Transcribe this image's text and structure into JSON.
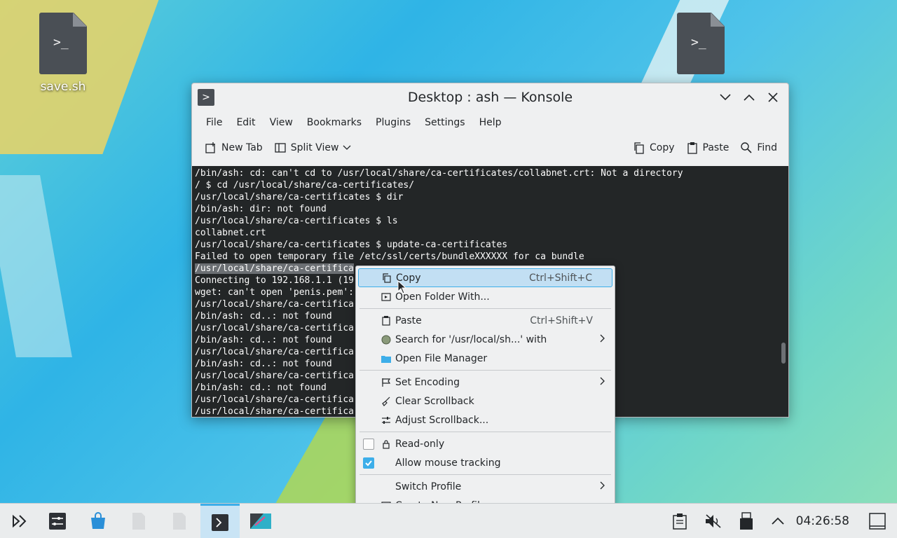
{
  "desktop": {
    "icons": [
      {
        "label": "save.sh"
      },
      {
        "label": ""
      }
    ]
  },
  "window": {
    "title": "Desktop : ash — Konsole",
    "menubar": [
      "File",
      "Edit",
      "View",
      "Bookmarks",
      "Plugins",
      "Settings",
      "Help"
    ],
    "toolbar": {
      "new_tab": "New Tab",
      "split_view": "Split View",
      "copy": "Copy",
      "paste": "Paste",
      "find": "Find"
    },
    "terminal_lines": [
      "/bin/ash: cd: can't cd to /usr/local/share/ca-certificates/collabnet.crt: Not a directory",
      "/ $ cd /usr/local/share/ca-certificates/",
      "/usr/local/share/ca-certificates $ dir",
      "/bin/ash: dir: not found",
      "/usr/local/share/ca-certificates $ ls",
      "collabnet.crt",
      "/usr/local/share/ca-certificates $ update-ca-certificates",
      "Failed to open temporary file /etc/ssl/certs/bundleXXXXXX for ca bundle",
      "/usr/local/share/ca-certifica",
      "Connecting to 192.168.1.1 (19",
      "wget: can't open 'penis.pem':",
      "/usr/local/share/ca-certifica",
      "/bin/ash: cd..: not found",
      "/usr/local/share/ca-certifica",
      "/bin/ash: cd..: not found",
      "/usr/local/share/ca-certifica",
      "/bin/ash: cd..: not found",
      "/usr/local/share/ca-certifica",
      "/bin/ash: cd.: not found",
      "/usr/local/share/ca-certifica",
      "/usr/local/share/ca-certifica"
    ]
  },
  "context_menu": {
    "copy": {
      "label": "Copy",
      "shortcut": "Ctrl+Shift+C"
    },
    "open_folder": {
      "label": "Open Folder With..."
    },
    "paste": {
      "label": "Paste",
      "shortcut": "Ctrl+Shift+V"
    },
    "search": {
      "label": "Search for '/usr/local/sh...' with"
    },
    "open_file_manager": {
      "label": "Open File Manager"
    },
    "set_encoding": {
      "label": "Set Encoding"
    },
    "clear_scrollback": {
      "label": "Clear Scrollback"
    },
    "adjust_scrollback": {
      "label": "Adjust Scrollback..."
    },
    "read_only": {
      "label": "Read-only",
      "checked": false
    },
    "mouse_tracking": {
      "label": "Allow mouse tracking",
      "checked": true
    },
    "switch_profile": {
      "label": "Switch Profile"
    },
    "create_profile": {
      "label": "Create New Profile..."
    }
  },
  "taskbar": {
    "clock": "04:26:58"
  },
  "colors": {
    "accent": "#3daee9",
    "terminal_bg": "#232627",
    "hover_bg": "#c2dff3"
  }
}
